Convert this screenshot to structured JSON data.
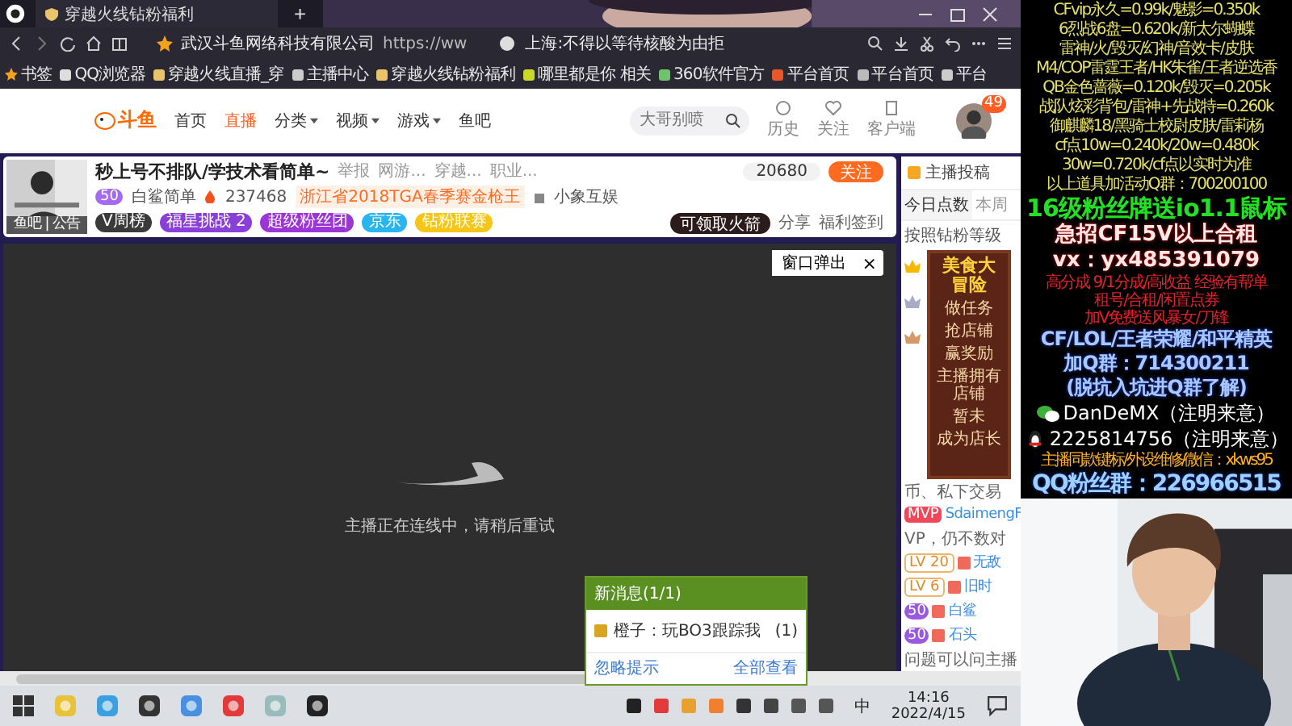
{
  "browser": {
    "tab_title": "穿越火线钻粉福利",
    "new_tab": "+",
    "site_name": "武汉斗鱼网络科技有限公司",
    "url": "https://ww",
    "news": "上海:不得以等待核酸为由拒"
  },
  "bookmarks": [
    "书签",
    "QQ浏览器",
    "穿越火线直播_穿",
    "主播中心",
    "穿越火线钻粉福利",
    "哪里都是你 相关",
    "360软件官方",
    "平台首页",
    "平台首页",
    "平台"
  ],
  "site": {
    "logo": "斗鱼",
    "nav": [
      {
        "label": "首页",
        "selected": false,
        "dropdown": false
      },
      {
        "label": "直播",
        "selected": true,
        "dropdown": false
      },
      {
        "label": "分类",
        "selected": false,
        "dropdown": true
      },
      {
        "label": "视频",
        "selected": false,
        "dropdown": true
      },
      {
        "label": "游戏",
        "selected": false,
        "dropdown": true
      },
      {
        "label": "鱼吧",
        "selected": false,
        "dropdown": false
      }
    ],
    "search_placeholder": "大哥别喷",
    "actions": [
      "历史",
      "关注",
      "客户端"
    ],
    "avatar_badge": "49"
  },
  "room": {
    "avatar_caption": "鱼吧 | 公告",
    "title": "秒上号不排队/学技术看简单~",
    "links": [
      "举报",
      "网游...",
      "穿越...",
      "职业..."
    ],
    "level": "50",
    "streamer": "白鲨简单",
    "heat": "237468",
    "honor": "浙江省2018TGA春季赛金枪王",
    "company": "小象互娱",
    "tags": [
      {
        "label": "V周榜",
        "color": "#3a3a3a"
      },
      {
        "label": "福星挑战 2",
        "color": "#8a3fd8"
      },
      {
        "label": "超级粉丝团",
        "color": "#9b35d6"
      },
      {
        "label": "京东",
        "color": "#2bb5f0"
      },
      {
        "label": "钻粉联赛",
        "color": "#f5c518"
      }
    ],
    "followers": "20680",
    "follow": "关注",
    "rocket": "可领取火箭",
    "share": "分享",
    "checkin": "福利签到"
  },
  "video": {
    "popout": "窗口弹出",
    "close": "×",
    "status": "主播正在连线中，请稍后重试"
  },
  "notification": {
    "title": "新消息(1/1)",
    "message": "橙子：玩BO3跟踪我",
    "count": "(1)",
    "ignore": "忽略提示",
    "view_all": "全部查看"
  },
  "chat": {
    "header": "主播投稿",
    "tabs": [
      {
        "label": "今日点数",
        "selected": true
      },
      {
        "label": "本周",
        "selected": false
      }
    ],
    "rank_hint": "按照钻粉等级",
    "ad": {
      "title": "美食大冒险",
      "lines": [
        "做任务",
        "抢店铺",
        "赢奖励",
        "主播拥有店铺",
        "暂未",
        "成为店长"
      ]
    },
    "messages": [
      {
        "kind": "text",
        "text": "币、私下交易"
      },
      {
        "kind": "mvp",
        "badge": "MVP",
        "name": "SdaimengF"
      },
      {
        "kind": "text",
        "text": "VP，仍不数对"
      },
      {
        "kind": "lv",
        "badge": "LV 20",
        "name": "无敌"
      },
      {
        "kind": "lv",
        "badge": "LV 6",
        "name": "旧时"
      },
      {
        "kind": "fan",
        "badge": "50",
        "name": "白鲨"
      },
      {
        "kind": "fan",
        "badge": "50",
        "name": "石头"
      },
      {
        "kind": "text",
        "text": "问题可以问主播"
      }
    ]
  },
  "taskbar": {
    "ime": "中",
    "time": "14:16",
    "date": "2022/4/15"
  },
  "overlay": {
    "lines": [
      {
        "kind": "yellow",
        "text": "CFvip永久=0.99k/魅影=0.350k"
      },
      {
        "kind": "yellow",
        "text": "6烈战6盘=0.620k/新太尔蝴蝶"
      },
      {
        "kind": "yellow",
        "text": "雷神/火/毁灭/幻神/音效卡/皮肤"
      },
      {
        "kind": "yellow",
        "text": "M4/COP雷霆王者/HK朱雀/王者逆选香"
      },
      {
        "kind": "yellow",
        "text": "QB金色蔷薇=0.120k/毁灭=0.205k"
      },
      {
        "kind": "yellow",
        "text": "战队炫彩背包/雷神+先战特=0.260k"
      },
      {
        "kind": "yellow",
        "text": "御麒麟18/黑骑士校尉皮肤/雷莉杨"
      },
      {
        "kind": "yellow",
        "text": "cf点10w=0.240k/20w=0.480k"
      },
      {
        "kind": "yellow",
        "text": "30w=0.720k/cf点以实时为准"
      },
      {
        "kind": "yellow",
        "text": "以上道具加活动Q群：700200100"
      },
      {
        "kind": "green",
        "text": "16级粉丝牌送io1.1鼠标"
      },
      {
        "kind": "red",
        "text": "急招CF15V以上合租"
      },
      {
        "kind": "red",
        "text": "vx：yx485391079"
      },
      {
        "kind": "small-red",
        "text": "高分成 9/1分成/高收益 经验有帮单"
      },
      {
        "kind": "small-red",
        "text": "租号/合租/闲置点券"
      },
      {
        "kind": "small-red",
        "text": "加V免费送风暴女/刀锋"
      },
      {
        "kind": "blue",
        "text": "CF/LOL/王者荣耀/和平精英"
      },
      {
        "kind": "blue",
        "text": "加Q群：714300211"
      },
      {
        "kind": "blue",
        "text": "(脱坑入坑进Q群了解)"
      },
      {
        "kind": "wechat",
        "text": "DanDeMX（注明来意）"
      },
      {
        "kind": "qq",
        "text": "2225814756（注明来意）"
      },
      {
        "kind": "orange",
        "text": "主播同款键标/外设维修/微信：xkws95"
      },
      {
        "kind": "big-blue",
        "text": "QQ粉丝群：226966515"
      }
    ]
  }
}
